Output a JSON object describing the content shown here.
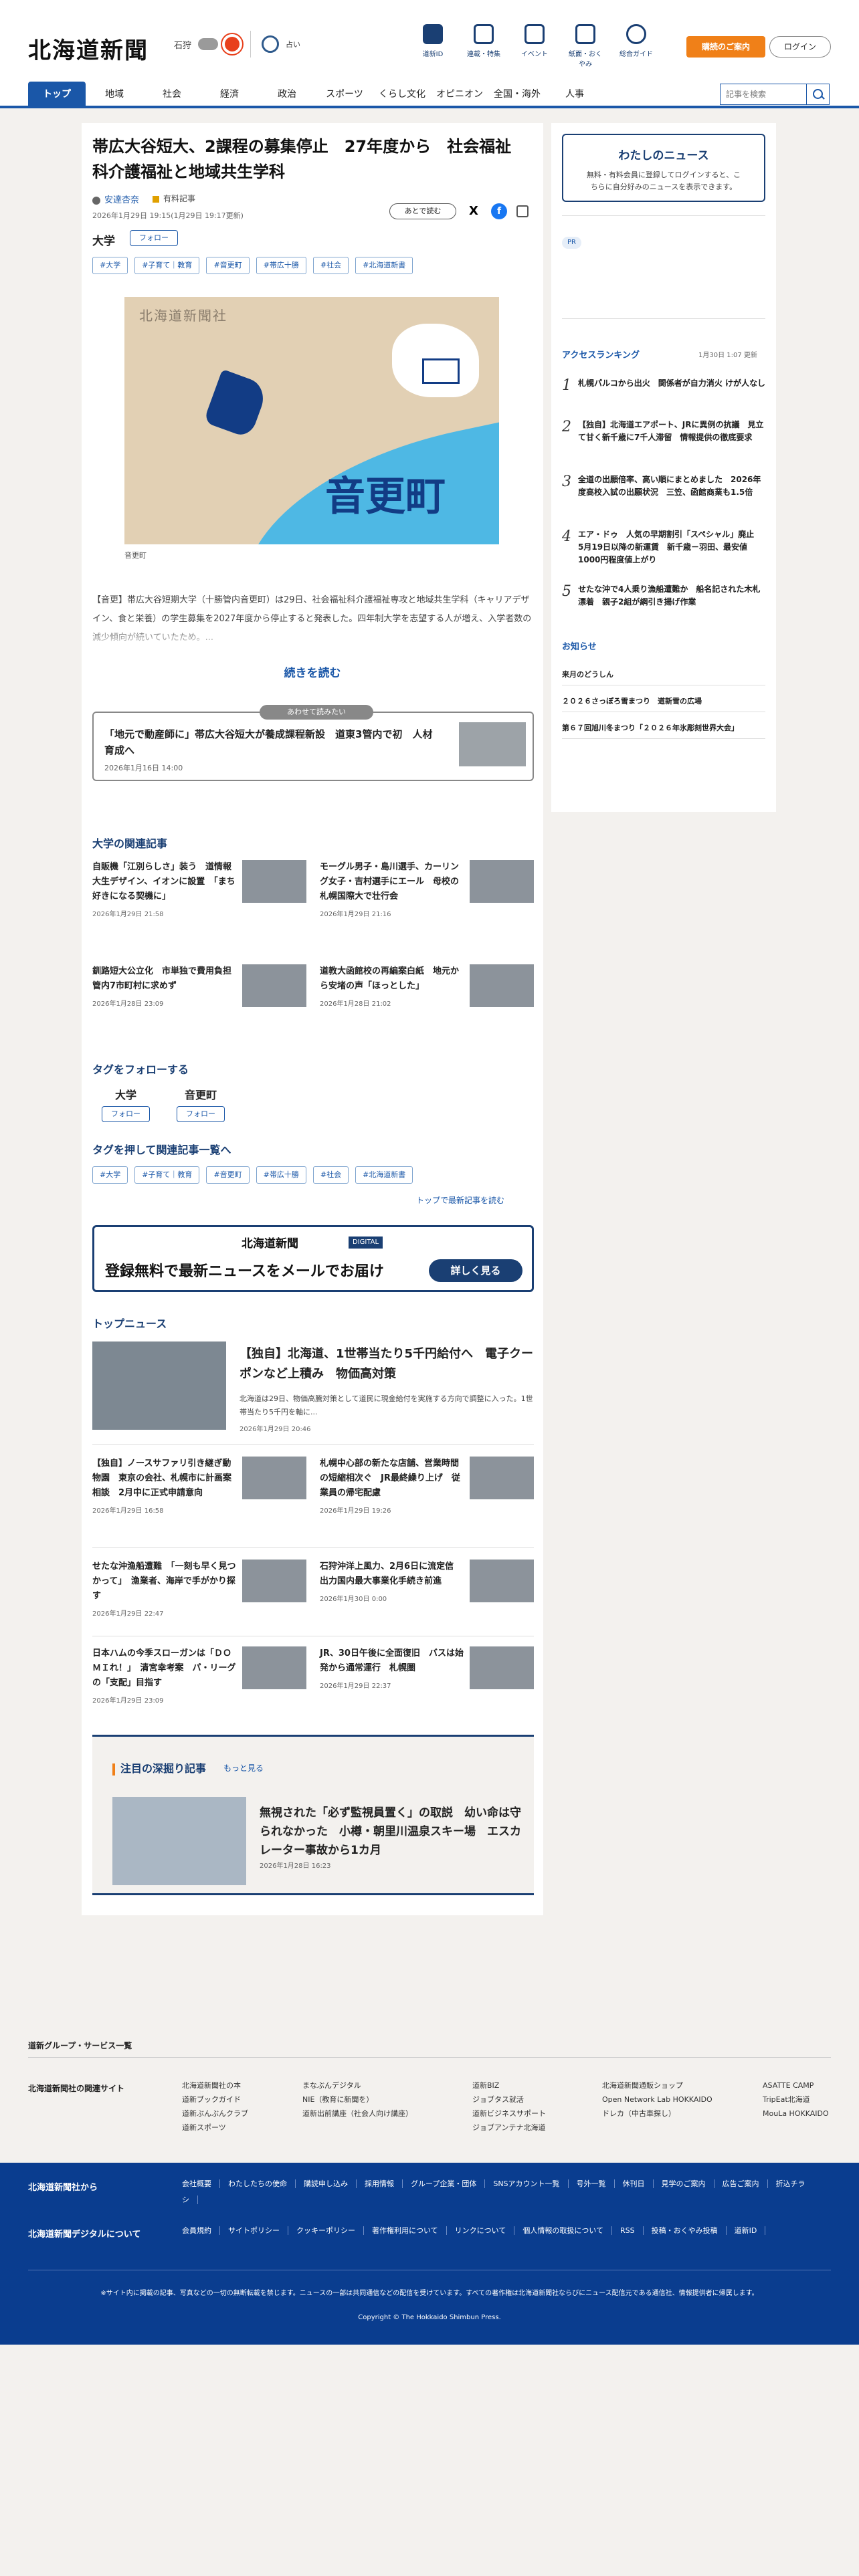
{
  "header": {
    "logo": "北海道新聞",
    "weather_area": "石狩",
    "weather_pct": "",
    "mood_label": "占い",
    "icons": [
      "道新ID",
      "連載・特集",
      "イベント",
      "紙面・おくやみ",
      "総合ガイド"
    ],
    "subscribe": "購読のご案内",
    "login": "ログイン",
    "search_placeholder": "記事を検索",
    "nav": [
      "トップ",
      "地域",
      "社会",
      "経済",
      "政治",
      "スポーツ",
      "くらし文化",
      "オピニオン",
      "全国・海外",
      "人事"
    ]
  },
  "article": {
    "headline": "帯広大谷短大、2課程の募集停止　27年度から　社会福祉科介護福祉と地域共生学科",
    "author": "安達杏奈",
    "paid_label": "有料記事",
    "date": "2026年1月29日 19:15(1月29日 19:17更新)",
    "read_later": "あとで読む",
    "topic": "大学",
    "follow": "フォロー",
    "tags": [
      "#大学",
      "#子育て｜教育",
      "#音更町",
      "#帯広十勝",
      "#社会",
      "#北海道新書"
    ],
    "map_logo": "北海道新聞社",
    "map_label": "音更町",
    "caption": "音更町",
    "lead": "【音更】帯広大谷短期大学（十勝管内音更町）は29日、社会福祉科介護福祉専攻と地域共生学科（キャリアデザイン、食と栄養）の学生募集を2027年度から停止すると発表した。四年制大学を志望する人が増え、入学者数の減少傾向が続いていたため。...",
    "read_more": "続きを読む",
    "also": {
      "label": "あわせて読みたい",
      "title": "「地元で動産師に」帯広大谷短大が養成課程新設　道東3管内で初　人材育成へ",
      "date": "2026年1月16日 14:00"
    }
  },
  "related": {
    "title": "大学の関連記事",
    "items": [
      {
        "title": "自販機「江別らしさ」装う　道情報大生デザイン、イオンに設置　「まち好きになる契機に」",
        "date": "2026年1月29日 21:58"
      },
      {
        "title": "モーグル男子・島川選手、カーリング女子・吉村選手にエール　母校の札幌国際大で壮行会",
        "date": "2026年1月29日 21:16"
      },
      {
        "title": "釧路短大公立化　市単独で費用負担　管内7市町村に求めず",
        "date": "2026年1月28日 23:09"
      },
      {
        "title": "道教大函館校の再編案白紙　地元から安堵の声「ほっとした」",
        "date": "2026年1月28日 21:02"
      }
    ]
  },
  "follow_tags": {
    "title": "タグをフォローする",
    "items": [
      "大学",
      "音更町"
    ],
    "button": "フォロー"
  },
  "tag_list": {
    "title": "タグを押して関連記事一覧へ",
    "tags": [
      "#大学",
      "#子育て｜教育",
      "#音更町",
      "#帯広十勝",
      "#社会",
      "#北海道新書"
    ],
    "latest_link": "トップで最新記事を読む"
  },
  "mail_banner": {
    "brand": "北海道新聞",
    "digital": "DIGITAL",
    "message": "登録無料で最新ニュースをメールでお届け",
    "button": "詳しく見る"
  },
  "top_news": {
    "title": "トップニュース",
    "main": {
      "title": "【独自】北海道、1世帯当たり5千円給付へ　電子クーポンなど上積み　物価高対策",
      "summary": "北海道は29日、物価高騰対策として道民に現金給付を実施する方向で調整に入った。1世帯当たり5千円を軸に...",
      "date": "2026年1月29日 20:46"
    },
    "items": [
      {
        "title": "【独自】ノースサファリ引き継ぎ動物園　東京の会社、札幌市に計画案相談　2月中に正式申請意向",
        "date": "2026年1月29日 16:58"
      },
      {
        "title": "札幌中心部の新たな店舗、営業時間の短縮相次ぐ　JR最終繰り上げ　従業員の帰宅配慮",
        "date": "2026年1月29日 19:26"
      },
      {
        "title": "せたな沖漁船遭難　「一刻も早く見つかって」　漁業者、海岸で手がかり探す",
        "date": "2026年1月29日 22:47"
      },
      {
        "title": "石狩沖洋上風力、2月6日に流定信　出力国内最大事業化手続き前進",
        "date": "2026年1月30日 0:00"
      },
      {
        "title": "日本ハムの今季スローガンは「ＤＯＭＩれ！」　清宮幸考案　パ・リーグの「支配」目指す",
        "date": "2026年1月29日 23:09"
      },
      {
        "title": "JR、30日午後に全面復旧　バスは始発から通常運行　札幌圏",
        "date": "2026年1月29日 22:37"
      }
    ]
  },
  "deep": {
    "title": "注目の深掘り記事",
    "more": "もっと見る",
    "article_title": "無視された「必ず監視員置く」の取説　幼い命は守られなかった　小樽・朝里川温泉スキー場　エスカレーター事故から1カ月",
    "date": "2026年1月28日 16:23"
  },
  "side": {
    "mynews_title": "わたしのニュース",
    "mynews_text": "無料・有料会員に登録してログインすると、こちらに自分好みのニュースを表示できます。",
    "pr": "PR",
    "ranking_title": "アクセスランキング",
    "ranking_time": "1月30日 1:07 更新",
    "ranking": [
      "札幌パルコから出火　関係者が自力消火 けが人なし",
      "【独自】北海道エアポート、JRに異例の抗議　見立て甘く新千歳に7千人滞留　情報提供の徹底要求",
      "全道の出願倍率、高い順にまとめました　2026年度高校入試の出願状況　三笠、函館商業も1.5倍",
      "エア・ドゥ　人気の早期割引「スペシャル」廃止　5月19日以降の新運賃　新千歳－羽田、最安値1000円程度値上がり",
      "せたな沖で4人乗り漁船遭難か　船名記された木札漂着　親子2組が網引き揚げ作業"
    ],
    "notice_title": "お知らせ",
    "notices": [
      "来月のどうしん",
      "２０２６さっぽろ雪まつり　道新雪の広場",
      "第６７回旭川冬まつり「２０２６年氷彫刻世界大会」"
    ]
  },
  "footer": {
    "group_link": "道新グループ・サービス一覧",
    "related_sites_label": "北海道新聞社の関連サイト",
    "cols": [
      [
        "北海道新聞社の本",
        "道新ブックガイド",
        "道新ぶんぶんクラブ",
        "道新スポーツ"
      ],
      [
        "まなぶんデジタル",
        "NIE（教育に新聞を）",
        "道新出前講座（社会人向け講座）"
      ],
      [
        "道新BIZ",
        "ジョブタス就活",
        "道新ビジネスサポート",
        "ジョブアンテナ北海道"
      ],
      [
        "北海道新聞通販ショップ",
        "Open Network Lab HOKKAIDO",
        "ドレカ（中古車探し）"
      ],
      [
        "ASATTE CAMP",
        "TripEat北海道",
        "MouLa HOKKAIDO"
      ]
    ],
    "company_label": "北海道新聞社から",
    "company_links": [
      "会社概要",
      "わたしたちの使命",
      "購読申し込み",
      "採用情報",
      "グループ企業・団体",
      "SNSアカウント一覧",
      "号外一覧",
      "休刊日",
      "見学のご案内",
      "広告ご案内",
      "折込チラシ"
    ],
    "digital_label": "北海道新聞デジタルについて",
    "digital_links": [
      "会員規約",
      "サイトポリシー",
      "クッキーポリシー",
      "著作権利用について",
      "リンクについて",
      "個人情報の取扱について",
      "RSS",
      "投稿・おくやみ投稿",
      "道新ID"
    ],
    "note": "※サイト内に掲載の記事、写真などの一切の無断転載を禁じます。ニュースの一部は共同通信などの配信を受けています。すべての著作権は北海道新聞社ならびにニュース配信元である通信社、情報提供者に帰属します。",
    "copyright": "Copyright © The Hokkaido Shimbun Press."
  }
}
